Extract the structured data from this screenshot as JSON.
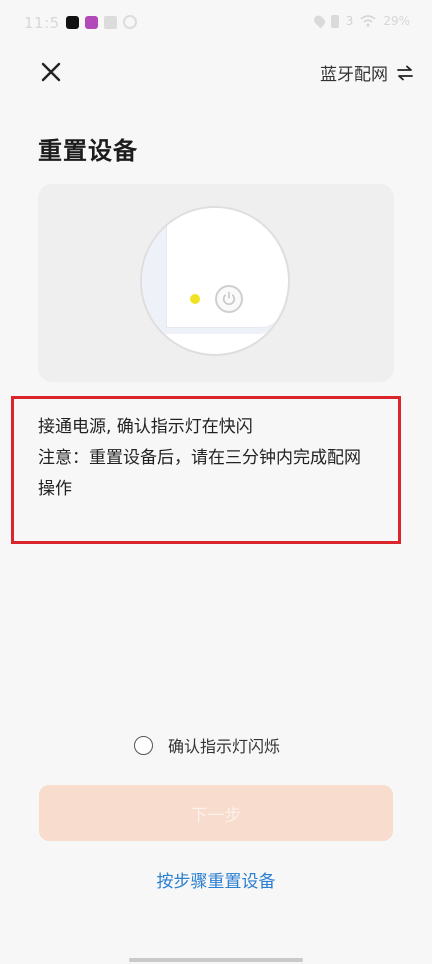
{
  "status_bar": {
    "time": "11:5",
    "battery": "29%",
    "signal": "3"
  },
  "header": {
    "mode_label": "蓝牙配网"
  },
  "page_title": "重置设备",
  "instructions": {
    "line1": "接通电源, 确认指示灯在快闪",
    "line2": "注意：重置设备后，请在三分钟内完成配网操作"
  },
  "confirm": {
    "label": "确认指示灯闪烁",
    "checked": false
  },
  "next_button": {
    "label": "下一步",
    "enabled": false
  },
  "step_link": {
    "label": "按步骤重置设备"
  },
  "colors": {
    "accent_link": "#2b7fd0",
    "button_disabled_bg": "#f8dccd",
    "highlight_border": "#d9252b",
    "indicator_light": "#f0e324"
  },
  "icons": {
    "close": "close-icon",
    "switch": "swap-arrows-icon",
    "power": "power-icon"
  }
}
